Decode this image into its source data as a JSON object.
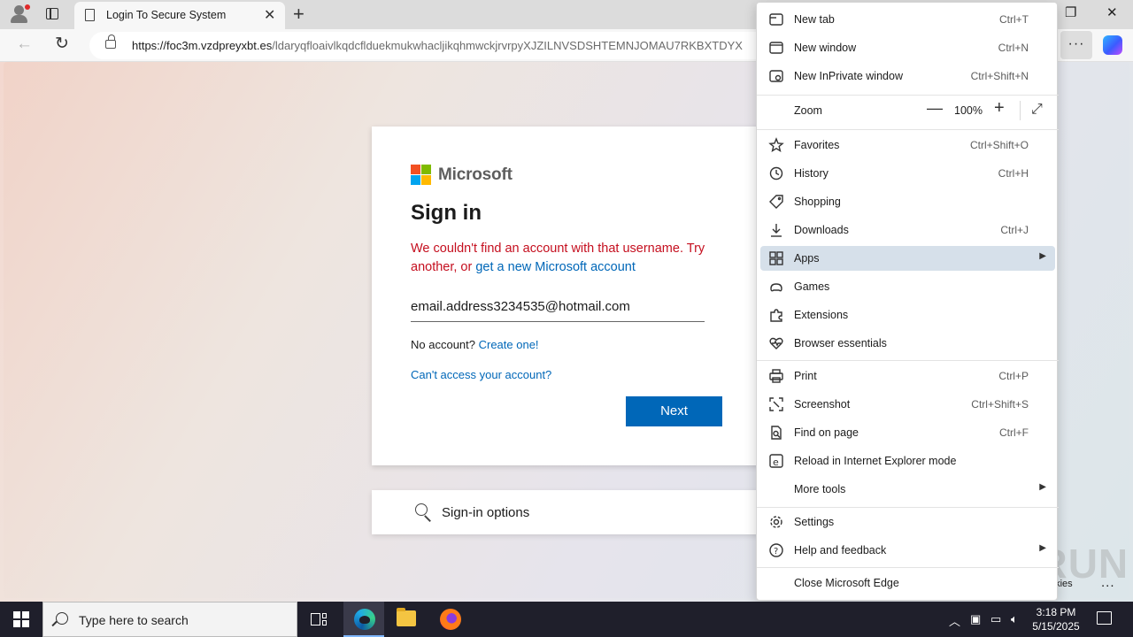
{
  "browser": {
    "tab_title": "Login To Secure System",
    "url_host": "https://foc3m.vzdpreyxbt.es",
    "url_path": "/ldaryqfloaivlkqdcflduekmukwhacljikqhmwckjrvrpyXJZILNVSDSHTEMNJOMAU7RKBXTDYX",
    "more_label": "···"
  },
  "signin": {
    "brand": "Microsoft",
    "title": "Sign in",
    "error_text": "We couldn't find an account with that username. Try another, or ",
    "error_link": "get a new Microsoft account",
    "email_value": "email.address3234535@hotmail.com",
    "no_account": "No account? ",
    "create_link": "Create one!",
    "cant_access": "Can't access your account?",
    "next_label": "Next",
    "signin_options": "Sign-in options",
    "cookies_text": "okies",
    "ellipsis": "..."
  },
  "watermark": "ANY RUN",
  "menu": {
    "items": [
      {
        "label": "New tab",
        "shortcut": "Ctrl+T",
        "icon": "new-tab-icon"
      },
      {
        "label": "New window",
        "shortcut": "Ctrl+N",
        "icon": "new-window-icon"
      },
      {
        "label": "New InPrivate window",
        "shortcut": "Ctrl+Shift+N",
        "icon": "inprivate-icon"
      },
      {
        "label": "Zoom",
        "value": "100%"
      },
      {
        "label": "Favorites",
        "shortcut": "Ctrl+Shift+O",
        "icon": "star-icon"
      },
      {
        "label": "History",
        "shortcut": "Ctrl+H",
        "icon": "history-icon"
      },
      {
        "label": "Shopping",
        "shortcut": "",
        "icon": "tag-icon"
      },
      {
        "label": "Downloads",
        "shortcut": "Ctrl+J",
        "icon": "download-icon"
      },
      {
        "label": "Apps",
        "shortcut": "",
        "icon": "apps-icon"
      },
      {
        "label": "Games",
        "shortcut": "",
        "icon": "games-icon"
      },
      {
        "label": "Extensions",
        "shortcut": "",
        "icon": "puzzle-icon"
      },
      {
        "label": "Browser essentials",
        "shortcut": "",
        "icon": "heart-pulse-icon"
      },
      {
        "label": "Print",
        "shortcut": "Ctrl+P",
        "icon": "printer-icon"
      },
      {
        "label": "Screenshot",
        "shortcut": "Ctrl+Shift+S",
        "icon": "screenshot-icon"
      },
      {
        "label": "Find on page",
        "shortcut": "Ctrl+F",
        "icon": "find-icon"
      },
      {
        "label": "Reload in Internet Explorer mode",
        "shortcut": "",
        "icon": "ie-icon"
      },
      {
        "label": "More tools",
        "shortcut": "",
        "icon": ""
      },
      {
        "label": "Settings",
        "shortcut": "",
        "icon": "gear-icon"
      },
      {
        "label": "Help and feedback",
        "shortcut": "",
        "icon": "help-icon"
      },
      {
        "label": "Close Microsoft Edge",
        "shortcut": "",
        "icon": ""
      }
    ]
  },
  "taskbar": {
    "search_placeholder": "Type here to search",
    "time": "3:18 PM",
    "date": "5/15/2025"
  },
  "colors": {
    "accent": "#0067b8",
    "error": "#c50f1f",
    "menu_highlight": "#d6e0ea"
  }
}
